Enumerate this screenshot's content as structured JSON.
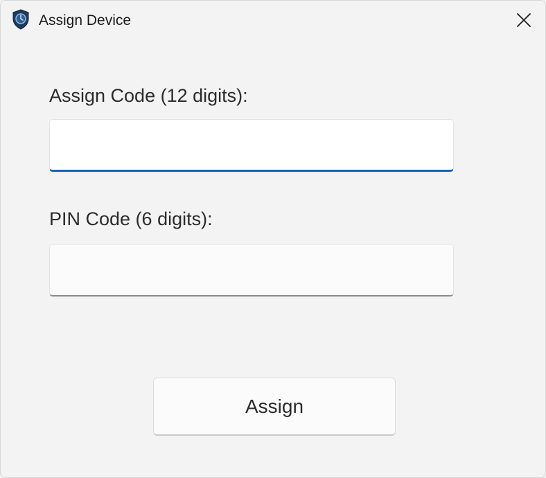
{
  "window": {
    "title": "Assign Device",
    "app_icon": "shield-icon",
    "close_icon": "close-icon"
  },
  "form": {
    "assign_code_label": "Assign Code (12 digits):",
    "assign_code_value": "",
    "pin_code_label": "PIN Code (6 digits):",
    "pin_code_value": ""
  },
  "actions": {
    "assign_label": "Assign"
  },
  "colors": {
    "focus_accent": "#1a5fb4",
    "icon_shield": "#1f3a5c"
  }
}
